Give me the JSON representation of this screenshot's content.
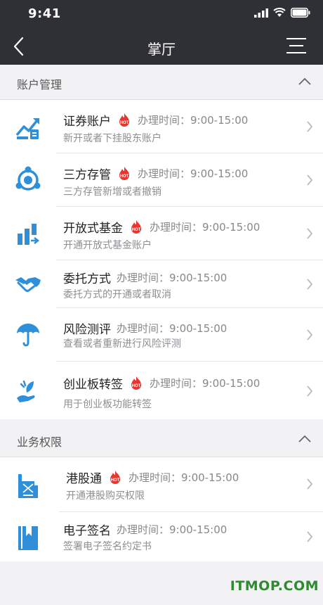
{
  "status": {
    "time": "9:41"
  },
  "nav": {
    "title": "掌厅"
  },
  "sections": [
    {
      "title": "账户管理",
      "items": [
        {
          "name": "证券账户",
          "hot": true,
          "time": "办理时间：9:00-15:00",
          "desc": "新开或者下挂股东账户",
          "icon": "stock-chart-icon"
        },
        {
          "name": "三方存管",
          "hot": true,
          "time": "办理时间：9:00-15:00",
          "desc": "三方存管新增或者撤销",
          "icon": "transfer-cycle-icon"
        },
        {
          "name": "开放式基金",
          "hot": true,
          "time": "办理时间：9:00-15:00",
          "desc": "开通开放式基金账户",
          "icon": "bar-chart-icon"
        },
        {
          "name": "委托方式",
          "hot": false,
          "time": "办理时间：9:00-15:00",
          "desc": "委托方式的开通或者取消",
          "icon": "handshake-icon"
        },
        {
          "name": "风险测评",
          "hot": false,
          "time": "办理时间：9:00-15:00",
          "desc": "查看或者重新进行风险评测",
          "icon": "umbrella-icon"
        },
        {
          "name": "创业板转签",
          "hot": true,
          "time": "办理时间：9:00-15:00",
          "desc": "用于创业板功能转签",
          "icon": "plant-hand-icon"
        }
      ]
    },
    {
      "title": "业务权限",
      "items": [
        {
          "name": "港股通",
          "hot": true,
          "time": "办理时间：9:00-15:00",
          "desc": "开通港股购买权限",
          "icon": "building-icon"
        },
        {
          "name": "电子签名",
          "hot": false,
          "time": "办理时间：9:00-15:00",
          "desc": "签署电子签名约定书",
          "icon": "bookmark-icon"
        }
      ]
    }
  ],
  "hot_badge": "HOT",
  "watermark": "ITMOP.COM",
  "colors": {
    "nav_bg": "#2f3035",
    "icon_blue": "#2f8fd8",
    "hot_red": "#e8352e",
    "watermark": "#2e8b2e"
  }
}
